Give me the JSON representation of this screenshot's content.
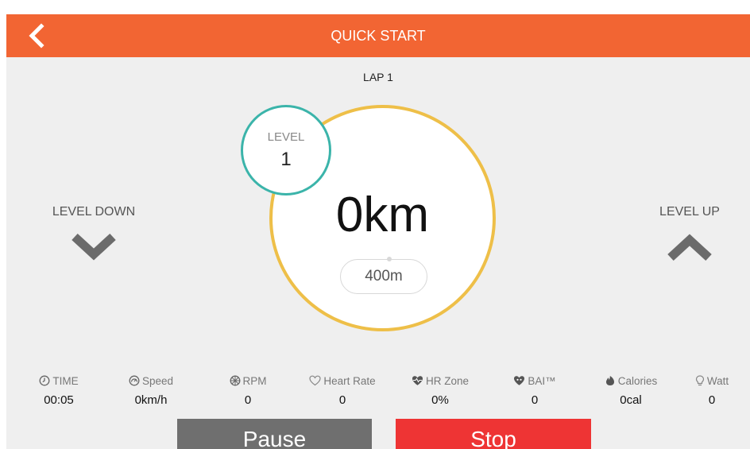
{
  "header": {
    "title": "QUICK START",
    "back_icon": "chevron-left-icon"
  },
  "lap": {
    "label": "LAP 1"
  },
  "level": {
    "label": "LEVEL",
    "value": "1"
  },
  "distance": {
    "value": "0km",
    "lap_length": "400m"
  },
  "controls": {
    "level_down": "LEVEL DOWN",
    "level_up": "LEVEL UP"
  },
  "stats": [
    {
      "icon": "clock-icon",
      "label": "TIME",
      "value": "00:05"
    },
    {
      "icon": "speedometer-icon",
      "label": "Speed",
      "value": "0km/h"
    },
    {
      "icon": "wheel-icon",
      "label": "RPM",
      "value": "0"
    },
    {
      "icon": "heart-outline-icon",
      "label": "Heart Rate",
      "value": "0"
    },
    {
      "icon": "heart-pulse-icon",
      "label": "HR Zone",
      "value": "0%"
    },
    {
      "icon": "heart-bai-icon",
      "label": "BAI™",
      "value": "0"
    },
    {
      "icon": "flame-icon",
      "label": "Calories",
      "value": "0cal"
    },
    {
      "icon": "bulb-icon",
      "label": "Watt",
      "value": "0"
    }
  ],
  "actions": {
    "pause": "Pause",
    "stop": "Stop"
  },
  "colors": {
    "header": "#f26533",
    "ring": "#eebf48",
    "level_ring": "#3bb4aa",
    "pause": "#6f6f6f",
    "stop": "#ee3434"
  }
}
